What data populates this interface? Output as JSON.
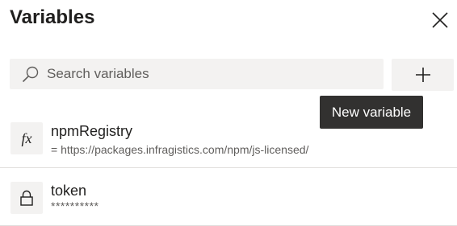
{
  "panel": {
    "title": "Variables",
    "close_icon": "close-icon"
  },
  "search": {
    "placeholder": "Search variables",
    "value": "",
    "icon": "search-icon"
  },
  "add_button": {
    "icon": "plus-icon",
    "tooltip": "New variable"
  },
  "variables": [
    {
      "name": "npmRegistry",
      "value": "= https://packages.infragistics.com/npm/js-licensed/",
      "icon": "fx-icon",
      "icon_text": "fx"
    },
    {
      "name": "token",
      "value": "**********",
      "icon": "lock-icon"
    }
  ],
  "colors": {
    "text": "#201f1e",
    "secondary_text": "#605e5c",
    "input_background": "#f3f2f1",
    "tooltip_background": "#323130",
    "divider": "#e1dfdd"
  }
}
